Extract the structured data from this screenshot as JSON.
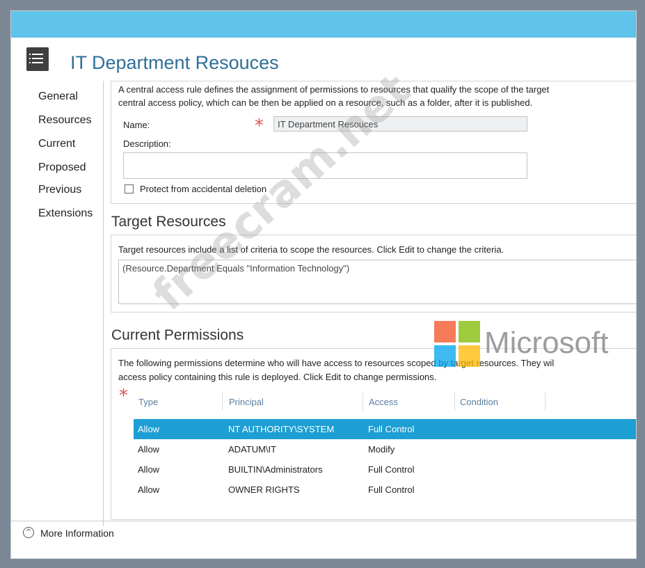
{
  "page": {
    "title": "IT Department Resouces",
    "watermark": "freecram.net",
    "brand_logo_text": "Microsoft"
  },
  "nav": {
    "items": [
      {
        "label": "General"
      },
      {
        "label": "Resources"
      },
      {
        "label": "Current"
      },
      {
        "label": "Proposed"
      },
      {
        "label": "Previous"
      },
      {
        "label": "Extensions"
      }
    ]
  },
  "general": {
    "description_line1": "A central access rule defines the assignment of permissions to resources that qualify the scope of the target",
    "description_line2": "central access policy, which can be then be applied on a resource, such as a folder, after it is published.",
    "name_label": "Name:",
    "name_value": "IT Department Resouces",
    "description_label": "Description:",
    "description_value": "",
    "protect_label": "Protect from accidental deletion",
    "protect_checked": false
  },
  "target_resources": {
    "title": "Target Resources",
    "intro": "Target resources include a list of criteria to scope the resources. Click Edit to change the criteria.",
    "criteria": "(Resource.Department Equals \"Information Technology\")"
  },
  "current_permissions": {
    "title": "Current Permissions",
    "intro_line1": "The following permissions determine who will have access to resources scoped by target resources. They wil",
    "intro_line2": "access policy containing this rule is deployed. Click Edit to change permissions.",
    "columns": [
      "Type",
      "Principal",
      "Access",
      "Condition"
    ],
    "rows": [
      {
        "type": "Allow",
        "principal": "NT AUTHORITY\\SYSTEM",
        "access": "Full Control",
        "condition": "",
        "selected": true
      },
      {
        "type": "Allow",
        "principal": "ADATUM\\IT",
        "access": "Modify",
        "condition": "",
        "selected": false
      },
      {
        "type": "Allow",
        "principal": "BUILTIN\\Administrators",
        "access": "Full Control",
        "condition": "",
        "selected": false
      },
      {
        "type": "Allow",
        "principal": "OWNER RIGHTS",
        "access": "Full Control",
        "condition": "",
        "selected": false
      }
    ]
  },
  "footer": {
    "more_info": "More Information"
  },
  "colors": {
    "titlebar": "#5fc3ea",
    "selection": "#1d9fd3",
    "title_text": "#2e6f99",
    "required_star": "#dd5555"
  }
}
